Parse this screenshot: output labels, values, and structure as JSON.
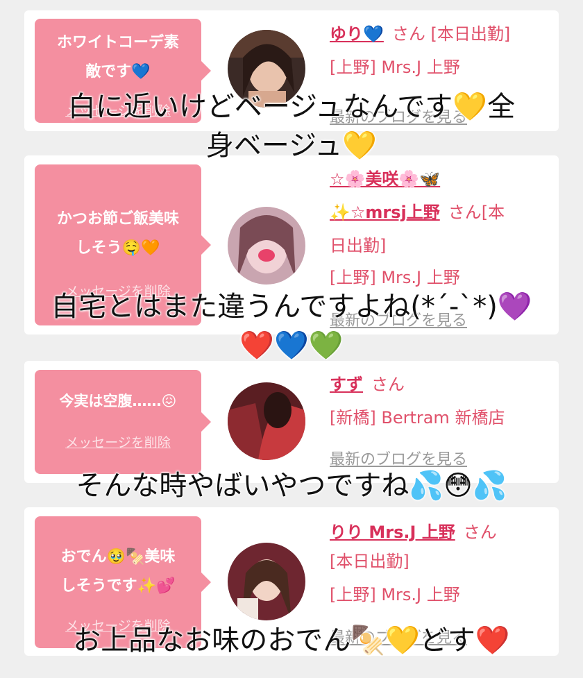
{
  "cards": [
    {
      "bubble_text": "ホワイトコーデ素\n敵です💙",
      "delete_label": "メッセージを削除",
      "name": "ゆり💙",
      "san": "さん",
      "extra": "[本日出勤]",
      "store": "[上野] Mrs.J 上野",
      "blog_label": "最新のブログを見る"
    },
    {
      "bubble_text": "かつお節ご飯美味\nしそう🤤🧡",
      "delete_label": "メッセージを削除",
      "name_line1": "☆🌸美咲🌸🦋",
      "name_line2": "✨☆mrsj上野",
      "san": "さん[本",
      "extra": "日出勤]",
      "store": "[上野] Mrs.J 上野",
      "blog_label": "最新のブログを見る"
    },
    {
      "bubble_text": "今実は空腹……😖",
      "delete_label": "メッセージを削除",
      "name": "すず",
      "san": "さん",
      "store": "[新橋] Bertram 新橋店",
      "blog_label": "最新のブログを見る"
    },
    {
      "bubble_text": "おでん🥹🍢美味\nしそうです✨💕",
      "delete_label": "メッセージを削除",
      "name": "りり Mrs.J 上野",
      "san": "さん",
      "extra": "[本日出勤]",
      "store": "[上野] Mrs.J 上野",
      "blog_label": "最新のブログを見る"
    }
  ],
  "captions": [
    "白に近いけどベージュなんです💛全\n身ベージュ💛",
    "自宅とはまた違うんですよね(*´-`*)💜\n❤️💙💚",
    "そんな時やばいやつですね💦😳💦",
    "お上品なお味のおでん🍢💛どす❤️"
  ],
  "colors": {
    "bubble": "#f48fa0",
    "name": "#d8305a",
    "text": "#e0506a",
    "background": "#efefef"
  }
}
